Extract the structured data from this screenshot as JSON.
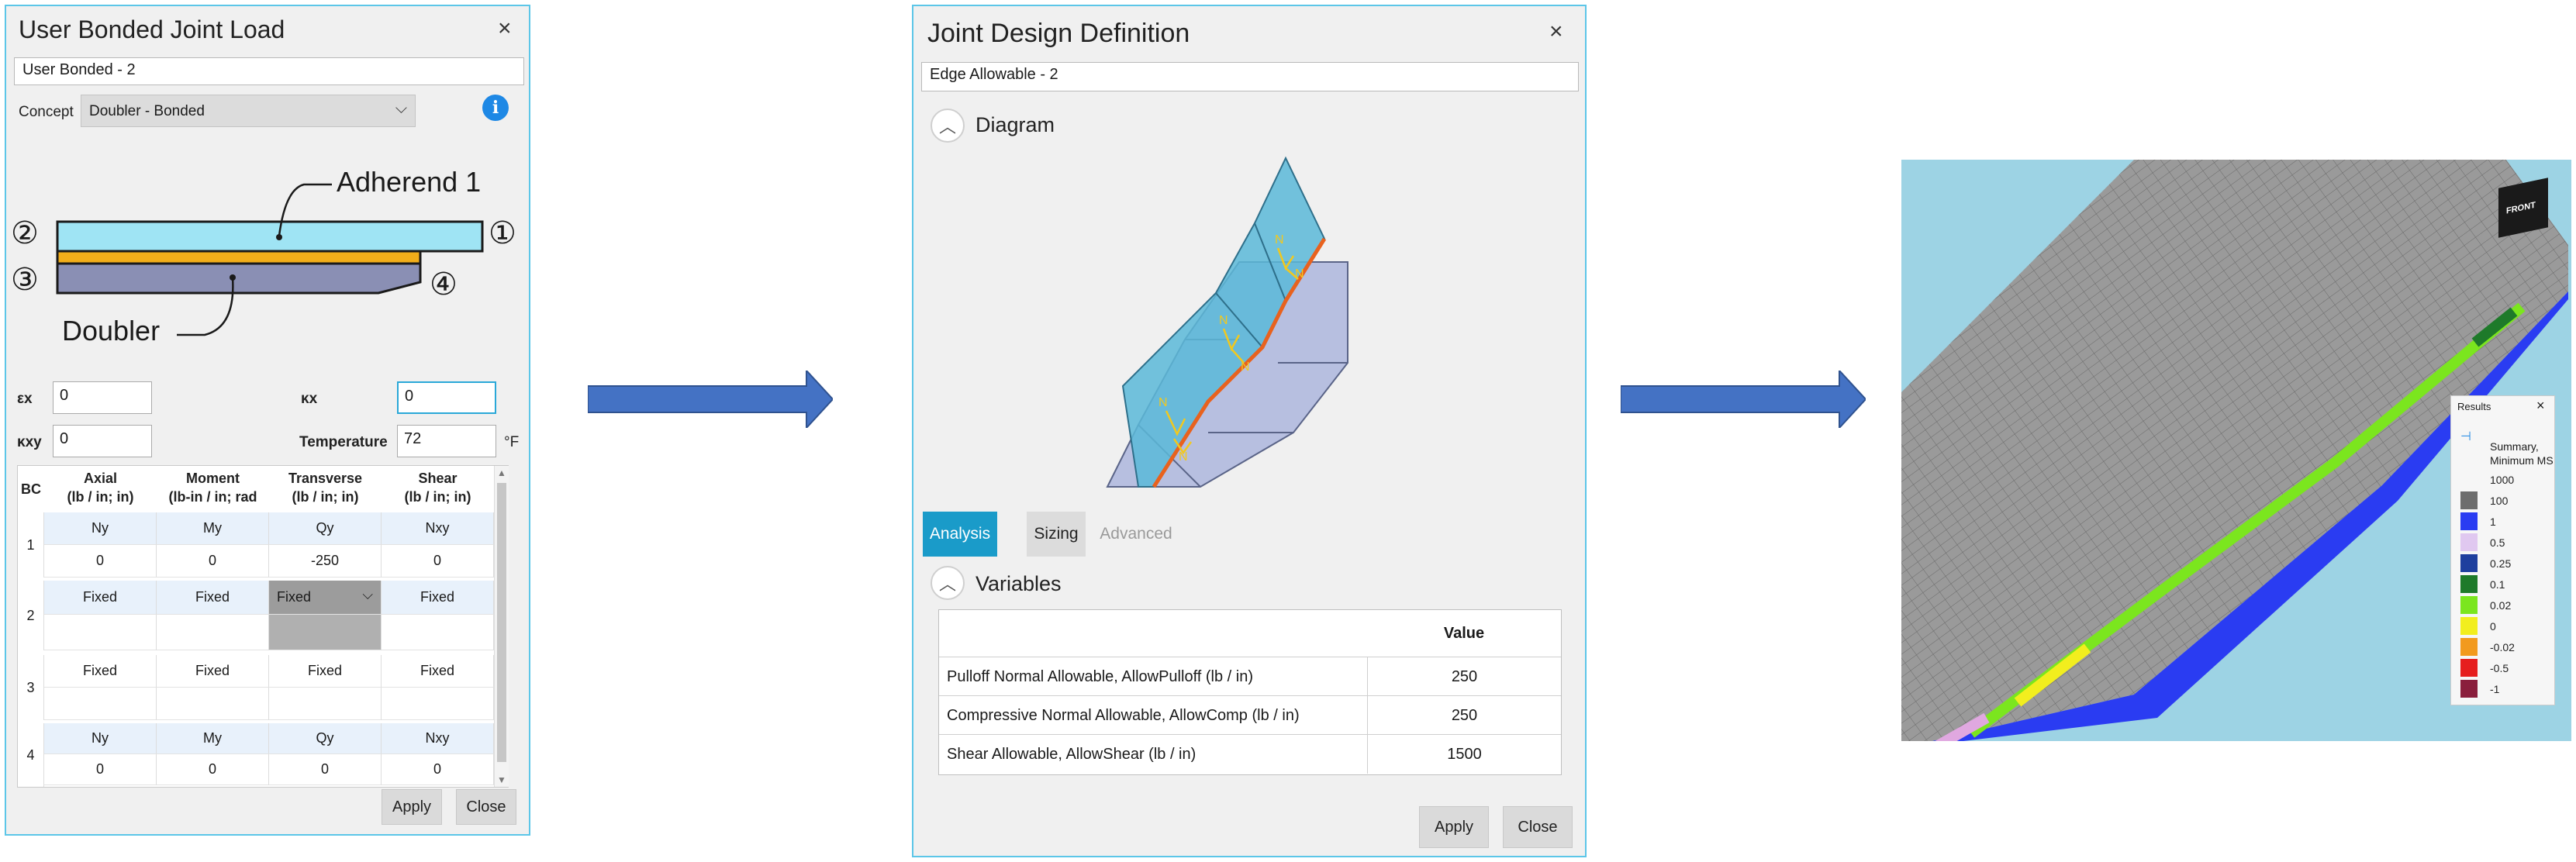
{
  "left_dialog": {
    "title": "User Bonded Joint Load",
    "close": "×",
    "name_value": "User Bonded - 2",
    "concept_label": "Concept",
    "concept_value": "Doubler - Bonded",
    "info_icon": "info-icon",
    "diagram": {
      "adherend_label": "Adherend 1",
      "doubler_label": "Doubler",
      "markers": [
        "②",
        "①",
        "③",
        "④"
      ]
    },
    "ex_label": "εx",
    "ex_value": "0",
    "kx_label": "κx",
    "kx_value": "0",
    "kxy_label": "κxy",
    "kxy_value": "0",
    "temperature_label": "Temperature",
    "temperature_value": "72",
    "temperature_unit": "°F",
    "table": {
      "bc_header": "BC",
      "columns": [
        {
          "name": "Axial",
          "unit": "(lb / in; in)"
        },
        {
          "name": "Moment",
          "unit": "(lb-in / in; rad"
        },
        {
          "name": "Transverse",
          "unit": "(lb / in; in)"
        },
        {
          "name": "Shear",
          "unit": "(lb / in; in)"
        }
      ],
      "rows": [
        {
          "bc": "1",
          "top": [
            "Ny",
            "My",
            "Qy",
            "Nxy"
          ],
          "bottom": [
            "0",
            "0",
            "-250",
            "0"
          ]
        },
        {
          "bc": "2",
          "top": [
            "Fixed",
            "Fixed",
            "Fixed",
            "Fixed"
          ],
          "bottom": [
            "",
            "",
            "",
            ""
          ]
        },
        {
          "bc": "3",
          "top": [
            "Fixed",
            "Fixed",
            "Fixed",
            "Fixed"
          ],
          "bottom": [
            "",
            "",
            "",
            ""
          ]
        },
        {
          "bc": "4",
          "top": [
            "Ny",
            "My",
            "Qy",
            "Nxy"
          ],
          "bottom": [
            "0",
            "0",
            "0",
            "0"
          ]
        }
      ]
    },
    "apply": "Apply",
    "close_btn": "Close"
  },
  "middle_dialog": {
    "title": "Joint Design Definition",
    "close": "×",
    "name_value": "Edge Allowable - 2",
    "diagram_section": "Diagram",
    "tabs": [
      "Analysis",
      "Sizing",
      "Advanced"
    ],
    "variables_section": "Variables",
    "value_header": "Value",
    "variables": [
      {
        "name": "Pulloff Normal Allowable, AllowPulloff (lb / in)",
        "value": "250"
      },
      {
        "name": "Compressive Normal Allowable, AllowComp (lb / in)",
        "value": "250"
      },
      {
        "name": "Shear Allowable, AllowShear (lb / in)",
        "value": "1500"
      }
    ],
    "apply": "Apply",
    "close_btn": "Close"
  },
  "arrows": [
    "right-arrow",
    "right-arrow"
  ],
  "viewport": {
    "cube_label": "FRONT",
    "legend": {
      "title": "Results",
      "close": "×",
      "caption_1": "Summary,",
      "caption_2": "Minimum MS",
      "entries": [
        {
          "label": "1000",
          "color": ""
        },
        {
          "label": "100",
          "color": "#6d6d6d"
        },
        {
          "label": "1",
          "color": "#2a3cf2"
        },
        {
          "label": "0.5",
          "color": "#e0c8f0"
        },
        {
          "label": "0.25",
          "color": "#1e3f9e"
        },
        {
          "label": "0.1",
          "color": "#1e7a2a"
        },
        {
          "label": "0.02",
          "color": "#7be61e"
        },
        {
          "label": "0",
          "color": "#f2ee1e"
        },
        {
          "label": "-0.02",
          "color": "#f29a1e"
        },
        {
          "label": "-0.5",
          "color": "#e61e1e"
        },
        {
          "label": "-1",
          "color": "#8a1e3c"
        }
      ]
    }
  },
  "colors": {
    "dialog_border": "#5cc6e8",
    "accent_tab": "#1a9bc9",
    "arrow": "#4472c4"
  }
}
